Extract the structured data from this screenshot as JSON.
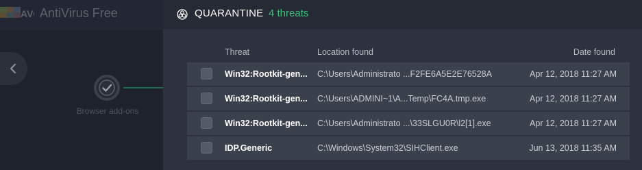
{
  "background_app": {
    "brand": "AVG",
    "product": "AntiVirus Free",
    "step_label": "Browser add-ons"
  },
  "quarantine": {
    "title": "QUARANTINE",
    "count_text": "4 threats",
    "columns": {
      "threat": "Threat",
      "location": "Location found",
      "date": "Date found"
    },
    "rows": [
      {
        "threat": "Win32:Rootkit-gen...",
        "location": "C:\\Users\\Administrato ...F2FE6A5E2E76528A",
        "date": "Apr 12, 2018 11:27 AM",
        "checked": false
      },
      {
        "threat": "Win32:Rootkit-gen...",
        "location": "C:\\Users\\ADMINI~1\\A...Temp\\FC4A.tmp.exe",
        "date": "Apr 12, 2018 11:27 AM",
        "checked": false
      },
      {
        "threat": "Win32:Rootkit-gen...",
        "location": "C:\\Users\\Administrato ...\\33SLGU0R\\l2[1].exe",
        "date": "Apr 12, 2018 11:27 AM",
        "checked": false
      },
      {
        "threat": "IDP.Generic",
        "location": "C:\\Windows\\System32\\SIHClient.exe",
        "date": "Jun 13, 2018 11:35 AM",
        "checked": false
      }
    ]
  },
  "icons": {
    "header": "biohazard-icon",
    "back": "chevron-left-icon",
    "step": "check-circle-icon"
  },
  "colors": {
    "accent_green": "#3fbf7f",
    "panel_bg": "#2d323e",
    "row_bg": "#3b404d"
  }
}
